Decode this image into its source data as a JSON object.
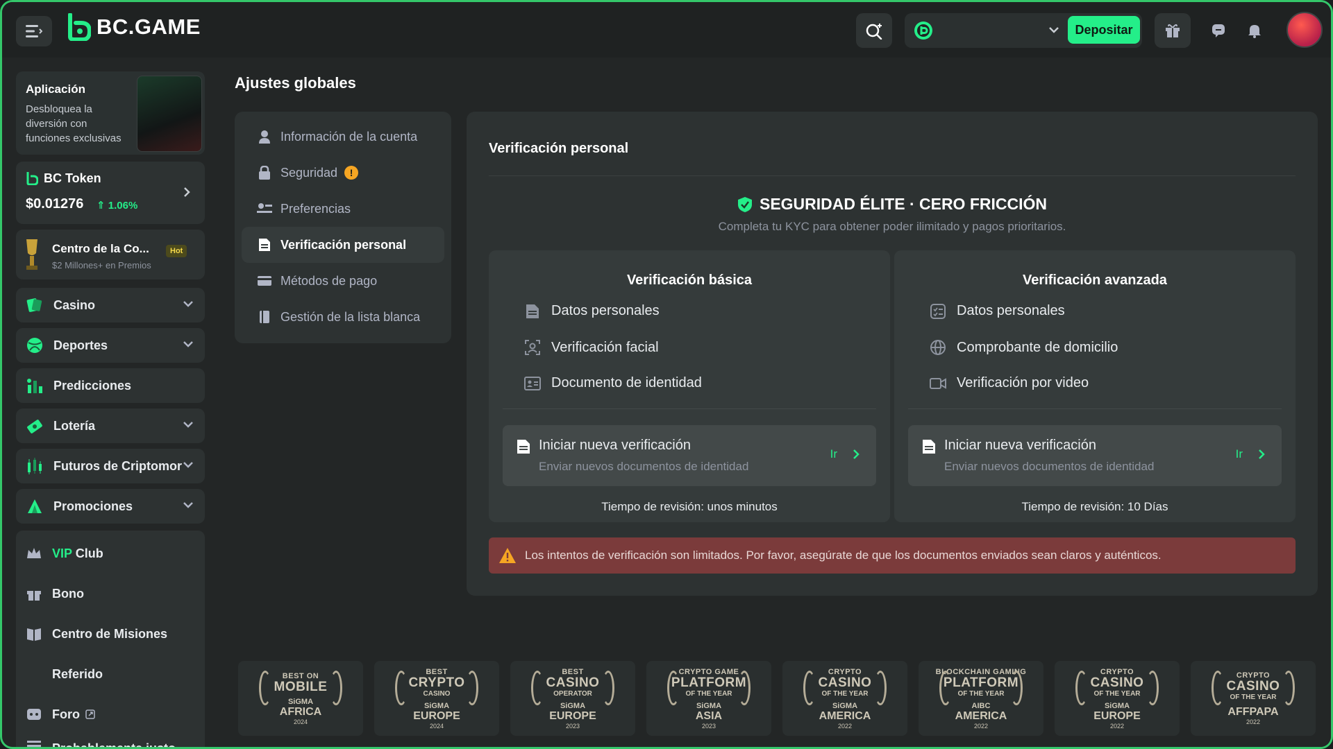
{
  "header": {
    "logo_text": "BC.GAME",
    "deposit_label": "Depositar"
  },
  "sidebar": {
    "app_card": {
      "title": "Aplicación",
      "desc": "Desbloquea la diversión con funciones exclusivas"
    },
    "token_card": {
      "title": "BC Token",
      "price": "$0.01276",
      "change": "1.06%"
    },
    "promo_card": {
      "title": "Centro de la Co...",
      "badge": "Hot",
      "sub": "$2 Millones+ en Premios"
    },
    "items": [
      {
        "label": "Casino",
        "icon": "casino-icon",
        "chevron": true
      },
      {
        "label": "Deportes",
        "icon": "sports-icon",
        "chevron": true
      },
      {
        "label": "Predicciones",
        "icon": "predictions-icon",
        "chevron": false
      },
      {
        "label": "Lotería",
        "icon": "lottery-icon",
        "chevron": true
      },
      {
        "label": "Futuros de Criptomor",
        "icon": "futures-icon",
        "chevron": true
      },
      {
        "label": "Promociones",
        "icon": "promotions-icon",
        "chevron": true
      }
    ],
    "group": {
      "vip_prefix": "VIP",
      "vip_suffix": "Club",
      "items": [
        {
          "label": "Bono",
          "icon": "gift-icon"
        },
        {
          "label": "Centro de Misiones",
          "icon": "missions-icon"
        },
        {
          "label": "Referido",
          "icon": ""
        },
        {
          "label": "Foro",
          "icon": "forum-icon"
        },
        {
          "label": "Probablemente justo",
          "icon": "fair-icon"
        }
      ]
    }
  },
  "page": {
    "title": "Ajustes globales",
    "menu": [
      {
        "label": "Información de la cuenta",
        "icon": "user-icon"
      },
      {
        "label": "Seguridad",
        "icon": "lock-icon",
        "alert": "!"
      },
      {
        "label": "Preferencias",
        "icon": "preferences-icon"
      },
      {
        "label": "Verificación personal",
        "icon": "document-icon",
        "active": true
      },
      {
        "label": "Métodos de pago",
        "icon": "card-icon"
      },
      {
        "label": "Gestión de la lista blanca",
        "icon": "whitelist-icon"
      }
    ]
  },
  "panel": {
    "title": "Verificación personal",
    "hero_title": "SEGURIDAD ÉLITE · CERO FRICCIÓN",
    "hero_sub": "Completa tu KYC para obtener poder ilimitado y pagos prioritarios.",
    "basic": {
      "title": "Verificación básica",
      "items": [
        "Datos personales",
        "Verificación facial",
        "Documento de identidad"
      ],
      "btn_title": "Iniciar nueva verificación",
      "btn_sub": "Enviar nuevos documentos de identidad",
      "go": "Ir",
      "time": "Tiempo de revisión: unos minutos"
    },
    "advanced": {
      "title": "Verificación avanzada",
      "items": [
        "Datos personales",
        "Comprobante de domicilio",
        "Verificación por video"
      ],
      "btn_title": "Iniciar nueva verificación",
      "btn_sub": "Enviar nuevos documentos de identidad",
      "go": "Ir",
      "time": "Tiempo de revisión: 10 Días"
    },
    "warning": "Los intentos de verificación son limitados. Por favor, asegúrate de que los documentos enviados sean claros y auténticos."
  },
  "awards": [
    {
      "t1": "BEST ON",
      "t2": "MOBILE",
      "t3": "",
      "org": "SiGMA",
      "reg": "AFRICA",
      "yr": "2024"
    },
    {
      "t1": "BEST",
      "t2": "CRYPTO",
      "t3": "CASINO",
      "org": "SiGMA",
      "reg": "EUROPE",
      "yr": "2024"
    },
    {
      "t1": "BEST",
      "t2": "CASINO",
      "t3": "OPERATOR",
      "org": "SiGMA",
      "reg": "EUROPE",
      "yr": "2023"
    },
    {
      "t1": "CRYPTO GAME",
      "t2": "PLATFORM",
      "t3": "OF THE YEAR",
      "org": "SiGMA",
      "reg": "ASIA",
      "yr": "2023"
    },
    {
      "t1": "CRYPTO",
      "t2": "CASINO",
      "t3": "OF THE YEAR",
      "org": "SiGMA",
      "reg": "AMERICA",
      "yr": "2022"
    },
    {
      "t1": "BLOCKCHAIN GAMING",
      "t2": "PLATFORM",
      "t3": "OF THE YEAR",
      "org": "AIBC",
      "reg": "AMERICA",
      "yr": "2022"
    },
    {
      "t1": "CRYPTO",
      "t2": "CASINO",
      "t3": "OF THE YEAR",
      "org": "SiGMA",
      "reg": "EUROPE",
      "yr": "2022"
    },
    {
      "t1": "CRYPTO",
      "t2": "CASINO",
      "t3": "OF THE YEAR",
      "org": "",
      "reg": "AFFPAPA",
      "yr": "2022"
    }
  ],
  "colors": {
    "accent": "#24ee89",
    "warning_bg": "#7b3b3b",
    "panel": "#2d3232"
  }
}
